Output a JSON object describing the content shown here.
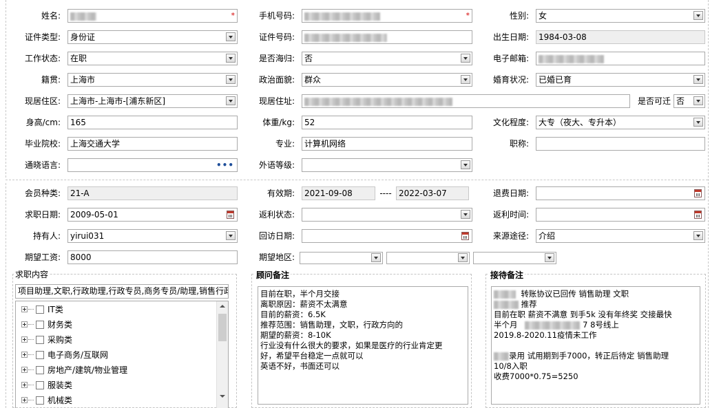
{
  "basic": {
    "name_label": "姓名:",
    "phone_label": "手机号码:",
    "gender_label": "性别:",
    "gender_value": "女",
    "id_type_label": "证件类型:",
    "id_type_value": "身份证",
    "id_no_label": "证件号码:",
    "birth_label": "出生日期:",
    "birth_value": "1984-03-08",
    "work_status_label": "工作状态:",
    "work_status_value": "在职",
    "overseas_label": "是否海归:",
    "overseas_value": "否",
    "email_label": "电子邮箱:",
    "native_label": "籍贯:",
    "native_value": "上海市",
    "political_label": "政治面貌:",
    "political_value": "群众",
    "marital_label": "婚育状况:",
    "marital_value": "已婚已育",
    "residence_area_label": "现居住区:",
    "residence_area_value": "上海市-上海市-[浦东新区]",
    "residence_addr_label": "现居住址:",
    "relocate_label": "是否可迁",
    "relocate_value": "否",
    "height_label": "身高/cm:",
    "height_value": "165",
    "weight_label": "体重/kg:",
    "weight_value": "52",
    "education_label": "文化程度:",
    "education_value": "大专（夜大、专升本）",
    "school_label": "毕业院校:",
    "school_value": "上海交通大学",
    "major_label": "专业:",
    "major_value": "计算机网络",
    "title_label": "职称:",
    "title_value": "",
    "language_label": "通晓语言:",
    "language_value": "",
    "language_more": "•••",
    "foreign_level_label": "外语等级:",
    "foreign_level_value": "",
    "required_mark": "*"
  },
  "member": {
    "type_label": "会员种类:",
    "type_value": "21-A",
    "valid_label": "有效期:",
    "valid_from": "2021-09-08",
    "valid_sep": "----",
    "valid_to": "2022-03-07",
    "refund_label": "退费日期:",
    "refund_value": "",
    "job_date_label": "求职日期:",
    "job_date_value": "2009-05-01",
    "rebate_status_label": "返利状态:",
    "rebate_status_value": "",
    "rebate_time_label": "返利时间:",
    "rebate_time_value": "",
    "holder_label": "持有人:",
    "holder_value": "yirui031",
    "visit_label": "回访日期:",
    "visit_value": "",
    "source_label": "来源途径:",
    "source_value": "介绍",
    "salary_label": "期望工资:",
    "salary_value": "8000",
    "region_label": "期望地区:"
  },
  "job_content": {
    "title": "求职内容",
    "summary": "项目助理,文职,行政助理,行政专员,商务专员/助理,销售行政",
    "categories": [
      "IT类",
      "财务类",
      "采购类",
      "电子商务/互联网",
      "房地产/建筑/物业管理",
      "服装类",
      "机械类"
    ]
  },
  "advisor_notes": {
    "title": "顾问备注",
    "text": "目前在职，半个月交接\n离职原因：薪资不太满意\n目前的薪资：6.5K\n推荐范围：销售助理，文职，行政方向的\n期望的薪资：8-10K\n行业没有什么很大的要求，如果是医疗的行业肯定更\n好，希望平台稳定一点就可以\n英语不好，书面还可以"
  },
  "reception_notes": {
    "title": "接待备注",
    "line1": "转账协议已回传  销售助理 文职",
    "line2": "推荐",
    "line3": "目前在职  薪资不满意 到手5k 没有年终奖  交接最快",
    "line4a": "半个月",
    "line4b": "7 8号线上",
    "line5": "2019.8-2020.11疫情未工作",
    "line6": "",
    "line7": "录用  试用期到手7000，转正后待定  销售助理",
    "line8": "10/8入职",
    "line9": "收费7000*0.75=5250"
  },
  "colors": {
    "required": "#d40000",
    "readonly_bg": "#efefef",
    "border": "#a9a9a9"
  },
  "icons": {
    "dropdown": "chevron-down-icon",
    "calendar": "calendar-icon",
    "more": "ellipsis-icon",
    "expand": "plus-box-icon",
    "checkbox": "checkbox-icon"
  }
}
